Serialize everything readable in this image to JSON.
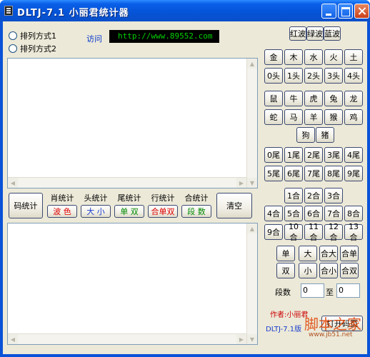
{
  "window": {
    "title": "DLTJ-7.1 小丽君统计器"
  },
  "options": {
    "sort1": "排列方式1",
    "sort2": "排列方式2"
  },
  "link": {
    "visit_label": "访问",
    "url": "http://www.89552.com"
  },
  "wave_buttons": [
    "红波",
    "绿波",
    "蓝波"
  ],
  "elements": [
    "金",
    "木",
    "水",
    "火",
    "土"
  ],
  "heads": [
    "0头",
    "1头",
    "2头",
    "3头",
    "4头"
  ],
  "zodiac_row1": [
    "鼠",
    "牛",
    "虎",
    "兔",
    "龙"
  ],
  "zodiac_row2": [
    "蛇",
    "马",
    "羊",
    "猴",
    "鸡"
  ],
  "zodiac_row3": [
    "狗",
    "猪"
  ],
  "tails_row1": [
    "0尾",
    "1尾",
    "2尾",
    "3尾",
    "4尾"
  ],
  "tails_row2": [
    "5尾",
    "6尾",
    "7尾",
    "8尾",
    "9尾"
  ],
  "sums_row1": [
    "1合",
    "2合",
    "3合"
  ],
  "sums_row2": [
    "4合",
    "5合",
    "6合",
    "7合",
    "8合"
  ],
  "sums_row3": [
    "9合",
    "10合",
    "11合",
    "12合",
    "13合"
  ],
  "size_row1": [
    "单",
    "大",
    "合大",
    "合单"
  ],
  "size_row2": [
    "双",
    "小",
    "合小",
    "合双"
  ],
  "segment": {
    "label": "段数",
    "from": "0",
    "to_label": "至",
    "to": "0"
  },
  "stats": {
    "code": "码统计",
    "groups": [
      {
        "top": "肖统计",
        "sub": "波 色",
        "color": "#e00000"
      },
      {
        "top": "头统计",
        "sub": "大 小",
        "color": "#1a3dcc"
      },
      {
        "top": "尾统计",
        "sub": "单 双",
        "color": "#008800"
      },
      {
        "top": "行统计",
        "sub": "合单双",
        "color": "#e00000"
      },
      {
        "top": "合统计",
        "sub": "段 数",
        "color": "#008800"
      }
    ],
    "clear": "清空"
  },
  "footer": {
    "author": "作者:小丽君",
    "version": "DLTJ-7.1版",
    "open": "打开",
    "code_page": "码页"
  },
  "watermark": {
    "brand": "脚本之家",
    "site": "www.jb51.net"
  }
}
